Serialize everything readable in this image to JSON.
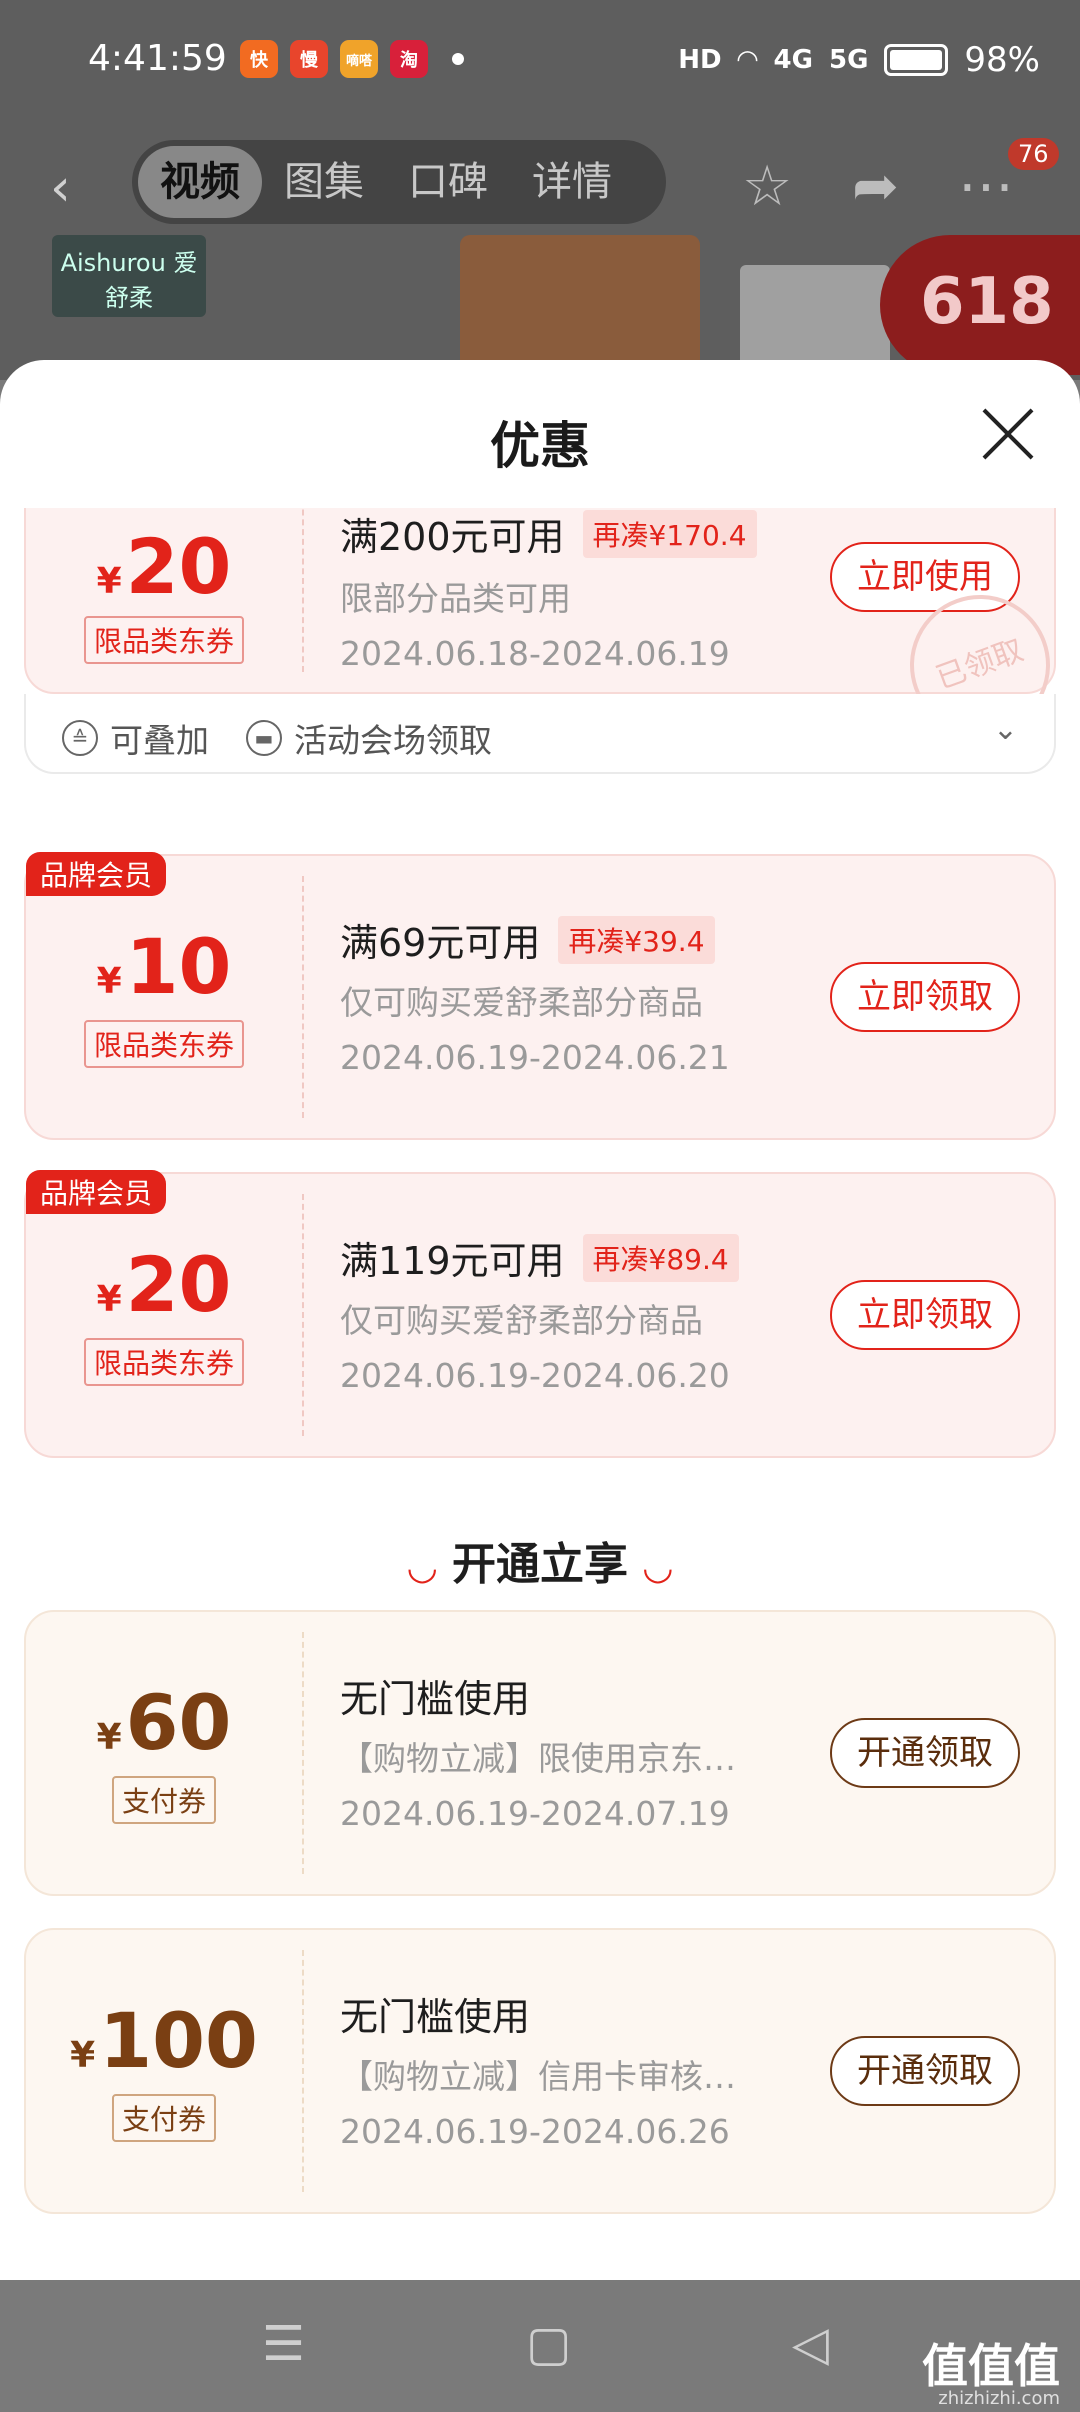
{
  "status_bar": {
    "time": "4:41:59",
    "app_icons": [
      {
        "label": "快",
        "color": "#f26b21"
      },
      {
        "label": "慢",
        "color": "#e8452c"
      },
      {
        "label": "嘀嗒",
        "color": "#f0a32a"
      },
      {
        "label": "淘",
        "color": "#d8203a"
      }
    ],
    "hd_label": "HD",
    "network_4g": "4G",
    "network_5g": "5G",
    "battery": "98%"
  },
  "header": {
    "tabs": [
      "视频",
      "图集",
      "口碑",
      "详情"
    ],
    "active_tab": "视频",
    "more_badge": "76"
  },
  "banner": {
    "brand": "Aishurou 爱舒柔",
    "sale": "618"
  },
  "sheet": {
    "title": "优惠"
  },
  "coupons": [
    {
      "amount": "20",
      "currency": "¥",
      "tag": "限品类东券",
      "title": "满200元可用",
      "pill": "再凑¥170.4",
      "desc": "限部分品类可用",
      "date": "2024.06.18-2024.06.19",
      "button": "立即使用",
      "stamp": "已领取"
    },
    {
      "member": "品牌会员",
      "amount": "10",
      "currency": "¥",
      "tag": "限品类东券",
      "title": "满69元可用",
      "pill": "再凑¥39.4",
      "desc": "仅可购买爱舒柔部分商品",
      "date": "2024.06.19-2024.06.21",
      "button": "立即领取"
    },
    {
      "member": "品牌会员",
      "amount": "20",
      "currency": "¥",
      "tag": "限品类东券",
      "title": "满119元可用",
      "pill": "再凑¥89.4",
      "desc": "仅可购买爱舒柔部分商品",
      "date": "2024.06.19-2024.06.20",
      "button": "立即领取"
    }
  ],
  "extra_row": {
    "stackable": "可叠加",
    "venue": "活动会场领取"
  },
  "section": {
    "title": "开通立享"
  },
  "pay_coupons": [
    {
      "amount": "60",
      "currency": "¥",
      "tag": "支付券",
      "title": "无门槛使用",
      "desc": "【购物立减】限使用京东…",
      "date": "2024.06.19-2024.07.19",
      "button": "开通领取"
    },
    {
      "amount": "100",
      "currency": "¥",
      "tag": "支付券",
      "title": "无门槛使用",
      "desc": "【购物立减】信用卡审核…",
      "date": "2024.06.19-2024.06.26",
      "button": "开通领取"
    }
  ],
  "watermark": {
    "main": "值值值",
    "sub": "zhizhizhi.com"
  },
  "colors": {
    "accent_red": "#e2231a",
    "gold_brown": "#7a3f13"
  }
}
